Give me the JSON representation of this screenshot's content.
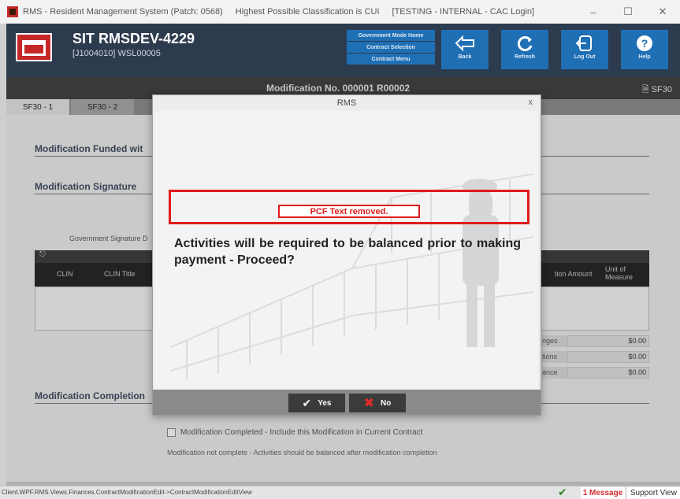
{
  "window": {
    "app_title": "RMS - Resident Management System (Patch: 0568)",
    "classification": "Highest Possible Classification is CUI",
    "environment": "[TESTING - INTERNAL - CAC Login]",
    "minimize": "–",
    "maximize": "☐",
    "close": "✕"
  },
  "header": {
    "title": "SIT RMSDEV-4229",
    "subtitle": "[J1004010] WSL00005",
    "gov_menu": [
      "Government Mode Home",
      "Contract Selection",
      "Contract Menu"
    ],
    "buttons": {
      "back": "Back",
      "refresh": "Refresh",
      "logout": "Log Out",
      "help": "Help"
    }
  },
  "subheader": {
    "modification": "Modification No. 000001 R00002",
    "sf30": "SF30"
  },
  "tabs": [
    "SF30 - 1",
    "SF30 - 2"
  ],
  "main": {
    "funded_heading": "Modification Funded wit",
    "signature_heading": "Modification Signature",
    "gov_signature_label": "Government Signature D",
    "grid": {
      "columns": {
        "clin": "CLIN",
        "clin_title": "CLIN Title",
        "amount": "tion Amount",
        "unit": "Unit of Measure"
      }
    },
    "totals": [
      {
        "label": "nges",
        "value": "$0.00"
      },
      {
        "label": "tions",
        "value": "$0.00"
      },
      {
        "label": "ance",
        "value": "$0.00"
      }
    ],
    "completion_heading": "Modification Completion",
    "checkbox_label": "Modification Completed - Include this Modification in Current Contract",
    "note": "Modification not complete - Activities should be balanced after modification completion"
  },
  "dialog": {
    "title": "RMS",
    "close": "x",
    "pcf_text": "PCF Text removed.",
    "message": "Activities will be required to be balanced prior to making payment - Proceed?",
    "yes_label": "Yes",
    "no_label": "No"
  },
  "statusbar": {
    "path": "Client.WPF.RMS.Views.Finances.ContractModificationEdit->ContractModificationEditView",
    "message": "1 Message",
    "support": "Support View"
  },
  "colors": {
    "header_bg": "#2d3b4e",
    "accent_blue": "#1f6fb5",
    "alert_red": "#e01b1b"
  }
}
